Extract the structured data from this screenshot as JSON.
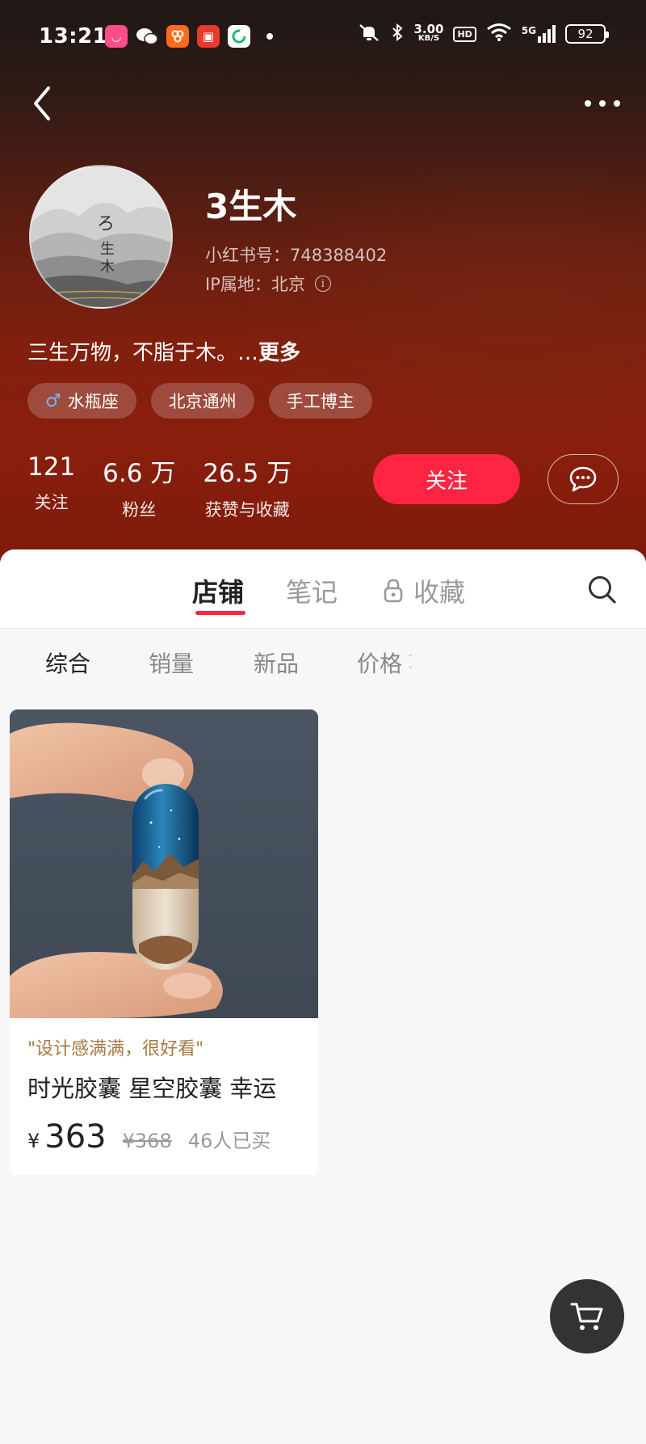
{
  "status_bar": {
    "time": "13:21",
    "net_speed_value": "3.00",
    "net_speed_unit": "KB/S",
    "hd": "HD",
    "signal": "5G",
    "battery": "92"
  },
  "profile": {
    "nickname": "3生木",
    "id_text": "小红书号：748388402",
    "ip_text": "IP属地：北京",
    "bio": "三生万物，不脂于木。…",
    "bio_more": "更多",
    "tags": [
      {
        "label": "水瓶座",
        "icon": "male-icon"
      },
      {
        "label": "北京通州"
      },
      {
        "label": "手工博主"
      }
    ],
    "stats": [
      {
        "num": "121",
        "label": "关注"
      },
      {
        "num": "6.6 万",
        "label": "粉丝"
      },
      {
        "num": "26.5 万",
        "label": "获赞与收藏"
      }
    ],
    "follow_label": "关注"
  },
  "tabs": {
    "shop": "店铺",
    "notes": "笔记",
    "collect": "收藏",
    "active": "shop"
  },
  "filters": {
    "items": [
      "综合",
      "销量",
      "新品",
      "价格"
    ],
    "active": 0
  },
  "products": [
    {
      "quote": "\"设计感满满，很好看\"",
      "title": "时光胶囊 星空胶囊 幸运",
      "currency": "¥",
      "price": "363",
      "original_price": "¥368",
      "sold": "46人已买"
    }
  ],
  "colors": {
    "accent": "#ff2442",
    "quote": "#a67a44"
  }
}
